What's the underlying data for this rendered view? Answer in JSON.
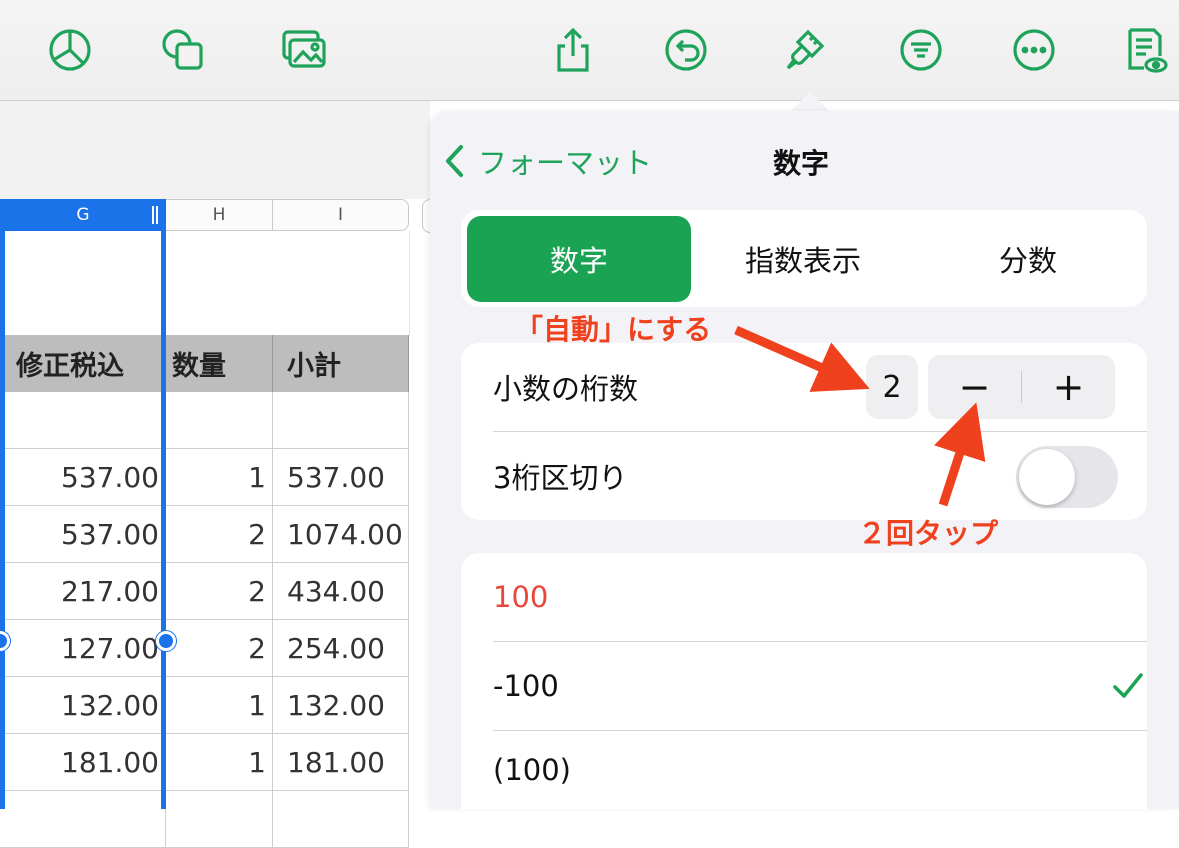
{
  "toolbar": {
    "icons": [
      "chart-icon",
      "shape-icon",
      "media-icon",
      "share-icon",
      "undo-icon",
      "format-brush-icon",
      "filter-icon",
      "more-icon",
      "document-view-icon"
    ]
  },
  "sheet": {
    "columns": [
      "G",
      "H",
      "I"
    ],
    "header_row": [
      "修正税込",
      "数量",
      "小計"
    ],
    "rows": [
      [
        "",
        "",
        ""
      ],
      [
        "537.00",
        "1",
        "537.00"
      ],
      [
        "537.00",
        "2",
        "1074.00"
      ],
      [
        "217.00",
        "2",
        "434.00"
      ],
      [
        "127.00",
        "2",
        "254.00"
      ],
      [
        "132.00",
        "1",
        "132.00"
      ],
      [
        "181.00",
        "1",
        "181.00"
      ]
    ]
  },
  "popover": {
    "back_label": "フォーマット",
    "title": "数字",
    "segments": [
      "数字",
      "指数表示",
      "分数"
    ],
    "active_segment": "数字",
    "decimal_places_label": "小数の桁数",
    "decimal_places_value": "2",
    "minus": "−",
    "plus": "+",
    "thousands_separator_label": "3桁区切り",
    "thousands_separator_on": false,
    "negative_formats": [
      "100",
      "-100",
      "(100)"
    ],
    "selected_format": "-100"
  },
  "annotations": {
    "auto": "「自動」にする",
    "tap_twice": "２回タップ"
  },
  "colors": {
    "accent_green": "#19a353",
    "selection_blue": "#1a73e8",
    "annotation_red": "#f0411f",
    "negative_red": "#e8473a"
  }
}
